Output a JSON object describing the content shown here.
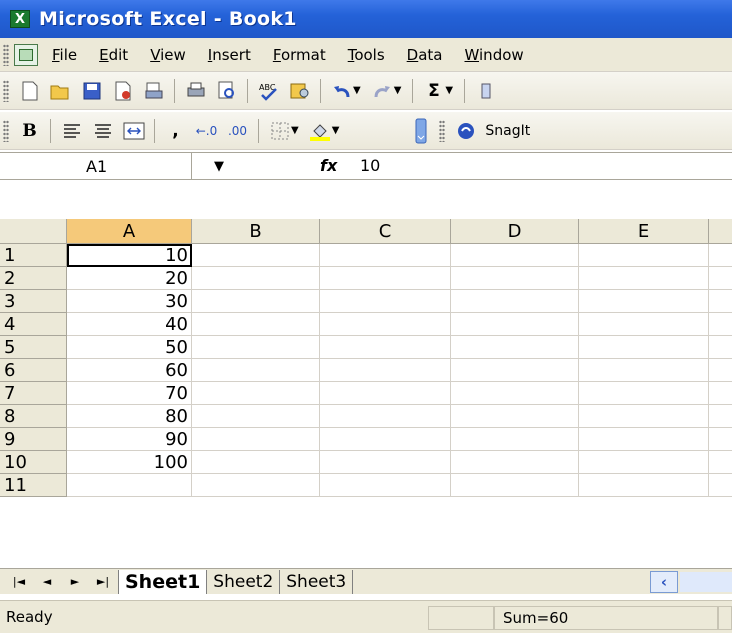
{
  "window": {
    "title": "Microsoft Excel - Book1",
    "app_icon_glyph": "X"
  },
  "menu": {
    "items": [
      "File",
      "Edit",
      "View",
      "Insert",
      "Format",
      "Tools",
      "Data",
      "Window"
    ]
  },
  "toolbar_standard": {
    "icons": [
      "new-icon",
      "open-icon",
      "save-icon",
      "permission-icon",
      "print-preview-icon",
      "print-icon",
      "print-preview-icon-2",
      "spelling-icon",
      "research-icon",
      "undo-icon",
      "redo-icon",
      "autosum-icon"
    ]
  },
  "toolbar_formatting": {
    "bold_glyph": "B",
    "comma_glyph": ",",
    "increase_decimal_glyph": "⁰₀₈",
    "decrease_decimal_glyph": ".00",
    "snagit_label": "SnagIt"
  },
  "formula_bar": {
    "name_box": "A1",
    "fx_label": "fx",
    "value": "10"
  },
  "grid": {
    "columns": [
      "A",
      "B",
      "C",
      "D",
      "E"
    ],
    "rows": [
      "1",
      "2",
      "3",
      "4",
      "5",
      "6",
      "7",
      "8",
      "9",
      "10",
      "11"
    ],
    "column_a_values": [
      "10",
      "20",
      "30",
      "40",
      "50",
      "60",
      "70",
      "80",
      "90",
      "100",
      ""
    ]
  },
  "sheets": {
    "tabs": [
      "Sheet1",
      "Sheet2",
      "Sheet3"
    ],
    "active": "Sheet1"
  },
  "status": {
    "ready": "Ready",
    "sum": "Sum=60"
  },
  "colors": {
    "title_bar": "#2462d8",
    "chrome": "#ece9d8",
    "selected_header": "#f5c97a"
  }
}
